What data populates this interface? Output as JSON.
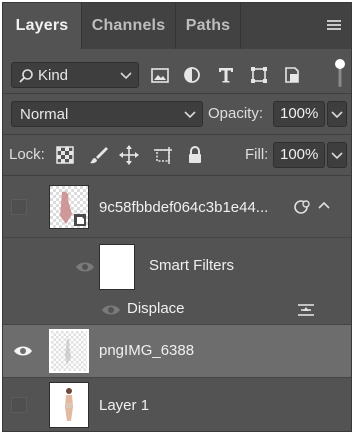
{
  "tabs": [
    {
      "label": "Layers",
      "active": true
    },
    {
      "label": "Channels",
      "active": false
    },
    {
      "label": "Paths",
      "active": false
    }
  ],
  "filter": {
    "kind_label": "Kind",
    "icons": [
      "image-filter-icon",
      "adjustment-filter-icon",
      "type-filter-icon",
      "shape-filter-icon",
      "smart-object-filter-icon"
    ]
  },
  "blend": {
    "mode": "Normal",
    "opacity_label": "Opacity:",
    "opacity_value": "100%"
  },
  "lock": {
    "label": "Lock:",
    "fill_label": "Fill:",
    "fill_value": "100%"
  },
  "layers": [
    {
      "name": "9c58fbbdef064c3b1e44...",
      "visible": false,
      "type": "smart-object"
    },
    {
      "name": "Smart Filters",
      "visible": true,
      "type": "smart-filters"
    },
    {
      "name": "Displace",
      "visible": true,
      "type": "filter"
    },
    {
      "name": "pngIMG_6388",
      "visible": true,
      "selected": true,
      "type": "image"
    },
    {
      "name": "Layer 1",
      "visible": false,
      "type": "image"
    }
  ],
  "colors": {
    "panel": "#535353",
    "tabbar": "#424242",
    "selected_row": "#6d6d6d"
  }
}
